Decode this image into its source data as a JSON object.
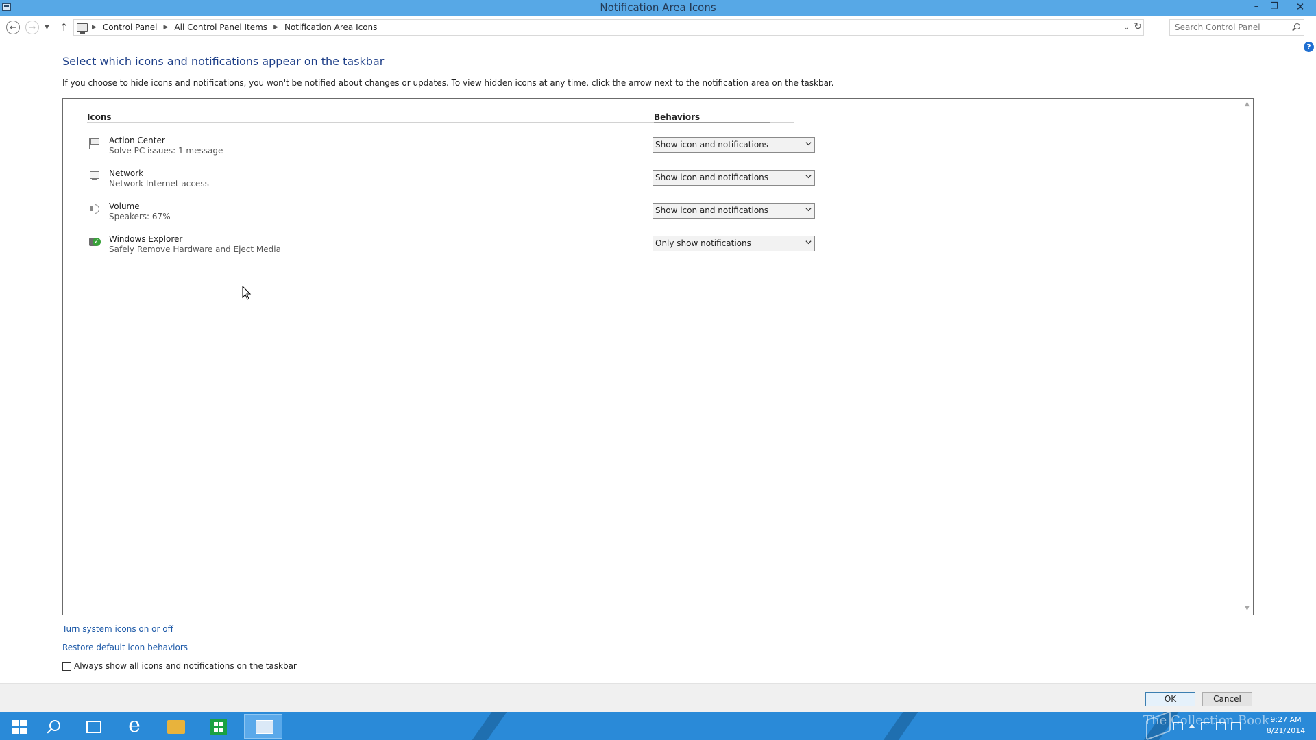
{
  "window": {
    "title": "Notification Area Icons",
    "minimize_glyph": "–",
    "restore_glyph": "❐",
    "close_glyph": "✕"
  },
  "nav": {
    "back_glyph": "←",
    "forward_glyph": "→",
    "recent_glyph": "▼",
    "up_glyph": "↑"
  },
  "breadcrumb": {
    "items": [
      "Control Panel",
      "All Control Panel Items",
      "Notification Area Icons"
    ],
    "separator": "▶",
    "dropdown_glyph": "⌄",
    "refresh_glyph": "↻"
  },
  "search": {
    "placeholder": "Search Control Panel"
  },
  "help_glyph": "?",
  "page": {
    "title": "Select which icons and notifications appear on the taskbar",
    "description": "If you choose to hide icons and notifications, you won't be notified about changes or updates. To view hidden icons at any time, click the arrow next to the notification area on the taskbar."
  },
  "table": {
    "col_icons": "Icons",
    "col_behaviors": "Behaviors",
    "rows": [
      {
        "name": "Action Center",
        "description": "Solve PC issues: 1 message",
        "behavior": "Show icon and notifications",
        "icon": "flag-icon"
      },
      {
        "name": "Network",
        "description": "Network Internet access",
        "behavior": "Show icon and notifications",
        "icon": "network-icon"
      },
      {
        "name": "Volume",
        "description": "Speakers: 67%",
        "behavior": "Show icon and notifications",
        "icon": "speaker-icon"
      },
      {
        "name": "Windows Explorer",
        "description": "Safely Remove Hardware and Eject Media",
        "behavior": "Only show notifications",
        "icon": "usb-eject-icon"
      }
    ],
    "scroll_up_glyph": "▲",
    "scroll_down_glyph": "▼"
  },
  "links": {
    "system_icons": "Turn system icons on or off",
    "restore_defaults": "Restore default icon behaviors"
  },
  "checkbox": {
    "label": "Always show all icons and notifications on the taskbar",
    "checked": false
  },
  "buttons": {
    "ok": "OK",
    "cancel": "Cancel"
  },
  "taskbar": {
    "ie_glyph": "e",
    "watermark": "The Collection Book",
    "clock_time": "9:27 AM",
    "clock_date": "8/21/2014",
    "accent": "#2a8ad8"
  },
  "colors": {
    "titlebar": "#57a8e6",
    "link": "#1e5aa8",
    "heading": "#1e3f88"
  }
}
